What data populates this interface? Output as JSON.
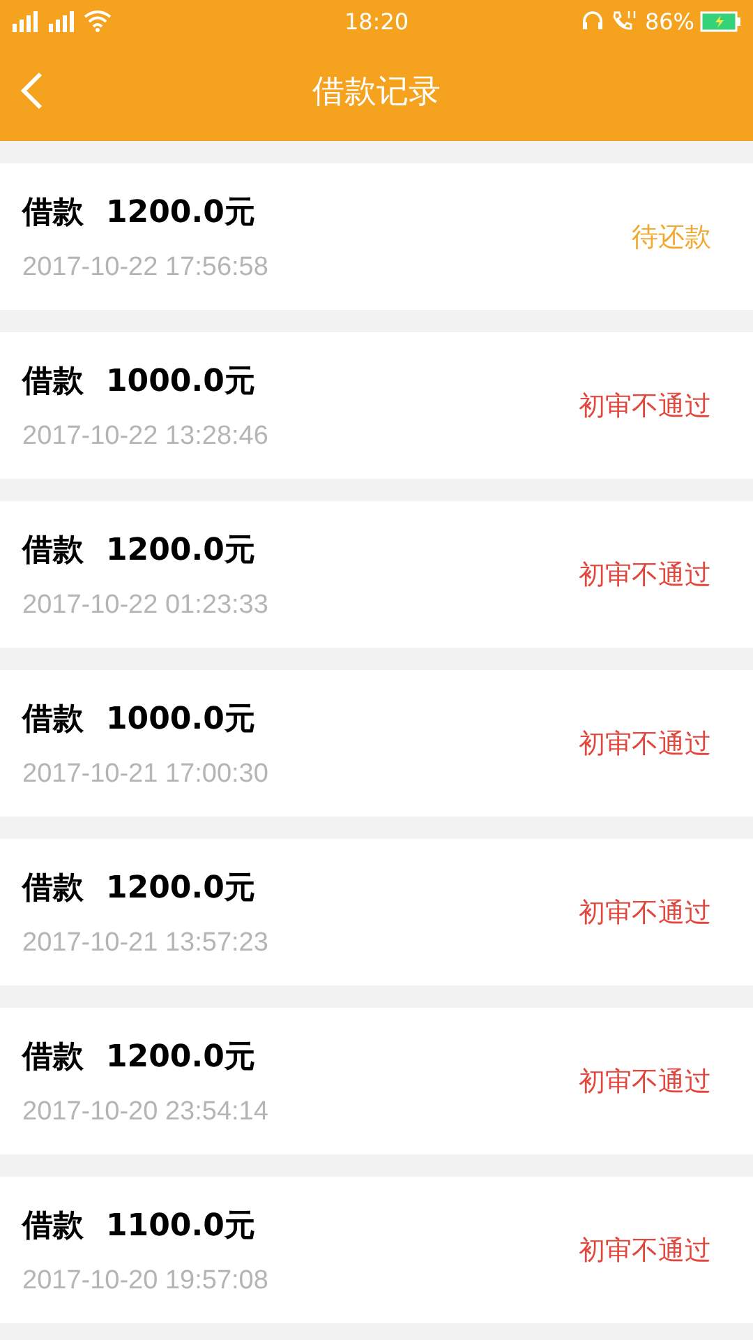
{
  "status_bar": {
    "time": "18:20",
    "battery": "86%"
  },
  "header": {
    "title": "借款记录"
  },
  "records": [
    {
      "label": "借款",
      "amount": "1200.0元",
      "time": "2017-10-22 17:56:58",
      "status": "待还款",
      "color": "#f0a92e"
    },
    {
      "label": "借款",
      "amount": "1000.0元",
      "time": "2017-10-22 13:28:46",
      "status": "初审不通过",
      "color": "#e2463c"
    },
    {
      "label": "借款",
      "amount": "1200.0元",
      "time": "2017-10-22 01:23:33",
      "status": "初审不通过",
      "color": "#e2463c"
    },
    {
      "label": "借款",
      "amount": "1000.0元",
      "time": "2017-10-21 17:00:30",
      "status": "初审不通过",
      "color": "#e2463c"
    },
    {
      "label": "借款",
      "amount": "1200.0元",
      "time": "2017-10-21 13:57:23",
      "status": "初审不通过",
      "color": "#e2463c"
    },
    {
      "label": "借款",
      "amount": "1200.0元",
      "time": "2017-10-20 23:54:14",
      "status": "初审不通过",
      "color": "#e2463c"
    },
    {
      "label": "借款",
      "amount": "1100.0元",
      "time": "2017-10-20 19:57:08",
      "status": "初审不通过",
      "color": "#e2463c"
    }
  ]
}
